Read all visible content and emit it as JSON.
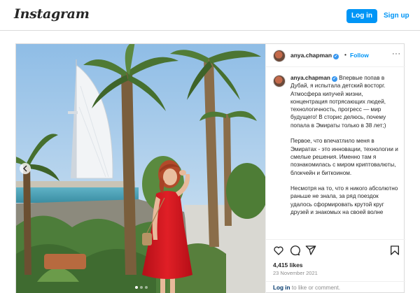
{
  "topbar": {
    "logo": "Instagram",
    "login_label": "Log in",
    "signup_label": "Sign up"
  },
  "post": {
    "username": "anya.chapman",
    "separator": "•",
    "follow_label": "Follow",
    "more_label": "···",
    "caption_lead": "Впервые попав в Дубай, я испытала детский восторг. Атмосфера кипучей жизни, концентрация потрясающих людей, технологичность, прогресс — мир будущего! В сторис делюсь, почему попала в Эмираты только в 38 лет;)",
    "caption_p2": "Первое, что впечатлило меня в Эмиратах - это инновации, технологии и смелые решения. Именно там я познакомилась с миром криптовалюты, блокчейн и биткоином.",
    "caption_p3": "Несмотря на то, что я никого абсолютно раньше не знала, за ряд поездок удалось сформировать крутой круг друзей и знакомых на своей волне",
    "likes": "4,415 likes",
    "date": "23 November 2021",
    "login_prompt_link": "Log in",
    "login_prompt_rest": " to like or comment.",
    "icons": {
      "like": "heart-icon",
      "comment": "comment-icon",
      "share": "share-icon",
      "save": "bookmark-icon",
      "verified": "verified-badge-icon"
    },
    "colors": {
      "accent": "#0095f6",
      "verified": "#3897f0",
      "dress": "#d9141d"
    }
  }
}
